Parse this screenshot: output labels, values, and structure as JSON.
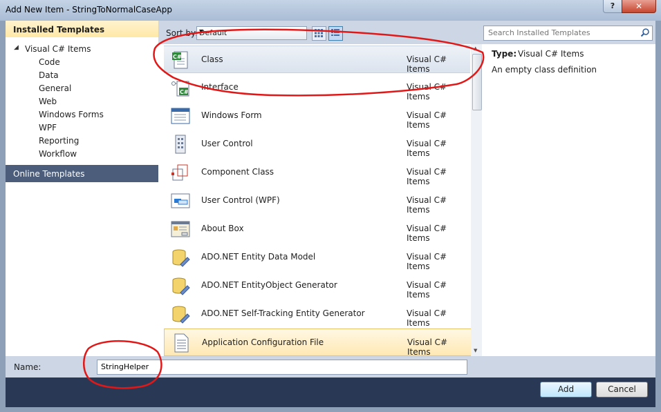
{
  "window": {
    "title": "Add New Item - StringToNormalCaseApp",
    "help": "?",
    "close": "✕"
  },
  "left": {
    "installed_header": "Installed Templates",
    "root": "Visual C# Items",
    "items": [
      "Code",
      "Data",
      "General",
      "Web",
      "Windows Forms",
      "WPF",
      "Reporting",
      "Workflow"
    ],
    "online_header": "Online Templates"
  },
  "toolbar": {
    "sort_label": "Sort by:",
    "sort_value": "Default"
  },
  "search": {
    "placeholder": "Search Installed Templates"
  },
  "templates": [
    {
      "name": "Class",
      "category": "Visual C# Items",
      "icon": "class-icon"
    },
    {
      "name": "Interface",
      "category": "Visual C# Items",
      "icon": "interface-icon"
    },
    {
      "name": "Windows Form",
      "category": "Visual C# Items",
      "icon": "windows-form-icon"
    },
    {
      "name": "User Control",
      "category": "Visual C# Items",
      "icon": "user-control-icon"
    },
    {
      "name": "Component Class",
      "category": "Visual C# Items",
      "icon": "component-class-icon"
    },
    {
      "name": "User Control (WPF)",
      "category": "Visual C# Items",
      "icon": "wpf-user-control-icon"
    },
    {
      "name": "About Box",
      "category": "Visual C# Items",
      "icon": "about-box-icon"
    },
    {
      "name": "ADO.NET Entity Data Model",
      "category": "Visual C# Items",
      "icon": "database-icon"
    },
    {
      "name": "ADO.NET EntityObject Generator",
      "category": "Visual C# Items",
      "icon": "database-icon"
    },
    {
      "name": "ADO.NET Self-Tracking Entity Generator",
      "category": "Visual C# Items",
      "icon": "database-icon"
    },
    {
      "name": "Application Configuration File",
      "category": "Visual C# Items",
      "icon": "config-file-icon"
    }
  ],
  "details": {
    "type_label": "Type:",
    "type_value": "Visual C# Items",
    "description": "An empty class definition"
  },
  "name_field": {
    "label": "Name:",
    "value": "StringHelper"
  },
  "buttons": {
    "add": "Add",
    "cancel": "Cancel"
  },
  "colors": {
    "selected_row": "#dbe3ee",
    "hover_row": "#ffe8b3",
    "annotation": "#e01818",
    "dialog_frame": "#293955"
  }
}
